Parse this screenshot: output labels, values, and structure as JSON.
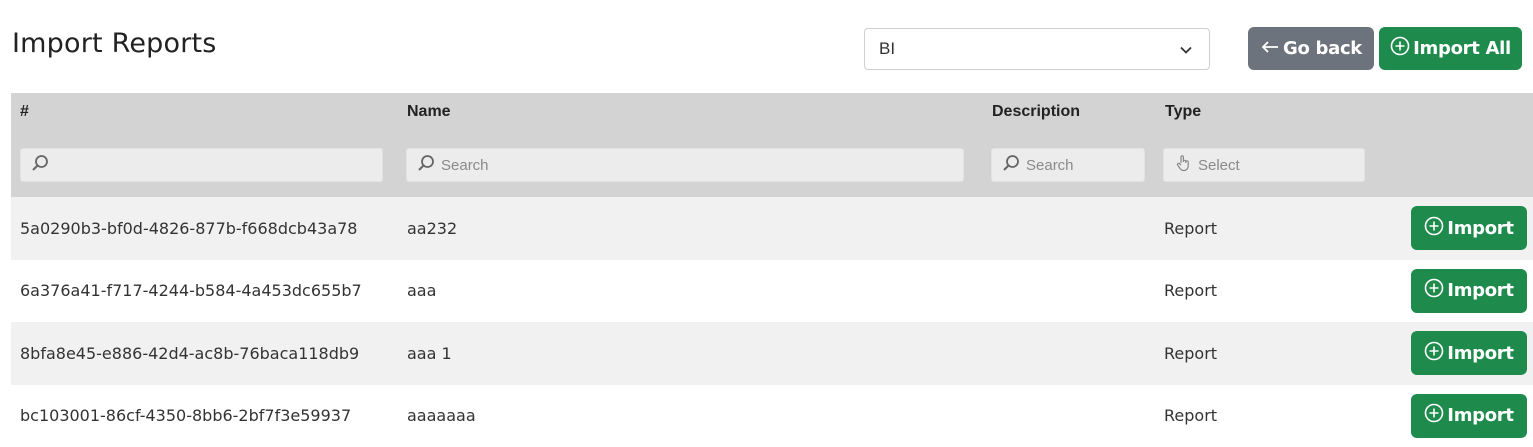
{
  "header": {
    "title": "Import Reports",
    "select": {
      "value": "BI",
      "icon": "chevron-down-icon"
    },
    "go_back_label": "Go back",
    "import_all_label": "Import All"
  },
  "table": {
    "columns": [
      "#",
      "Name",
      "Description",
      "Type"
    ],
    "filters": {
      "id_placeholder": "",
      "name_placeholder": "Search",
      "description_placeholder": "Search",
      "type_placeholder": "Select"
    },
    "import_label": "Import",
    "rows": [
      {
        "id": "5a0290b3-bf0d-4826-877b-f668dcb43a78",
        "name": "aa232",
        "description": "",
        "type": "Report"
      },
      {
        "id": "6a376a41-f717-4244-b584-4a453dc655b7",
        "name": "aaa",
        "description": "",
        "type": "Report"
      },
      {
        "id": "8bfa8e45-e886-42d4-ac8b-76baca118db9",
        "name": "aaa 1",
        "description": "",
        "type": "Report"
      },
      {
        "id": "bc103001-86cf-4350-8bb6-2bf7f3e59937",
        "name": "aaaaaaa",
        "description": "",
        "type": "Report"
      }
    ]
  },
  "colors": {
    "primary": "#1e8a4c",
    "secondary": "#6c737c",
    "header_bg": "#d3d3d3",
    "row_alt": "#f1f1f1"
  }
}
